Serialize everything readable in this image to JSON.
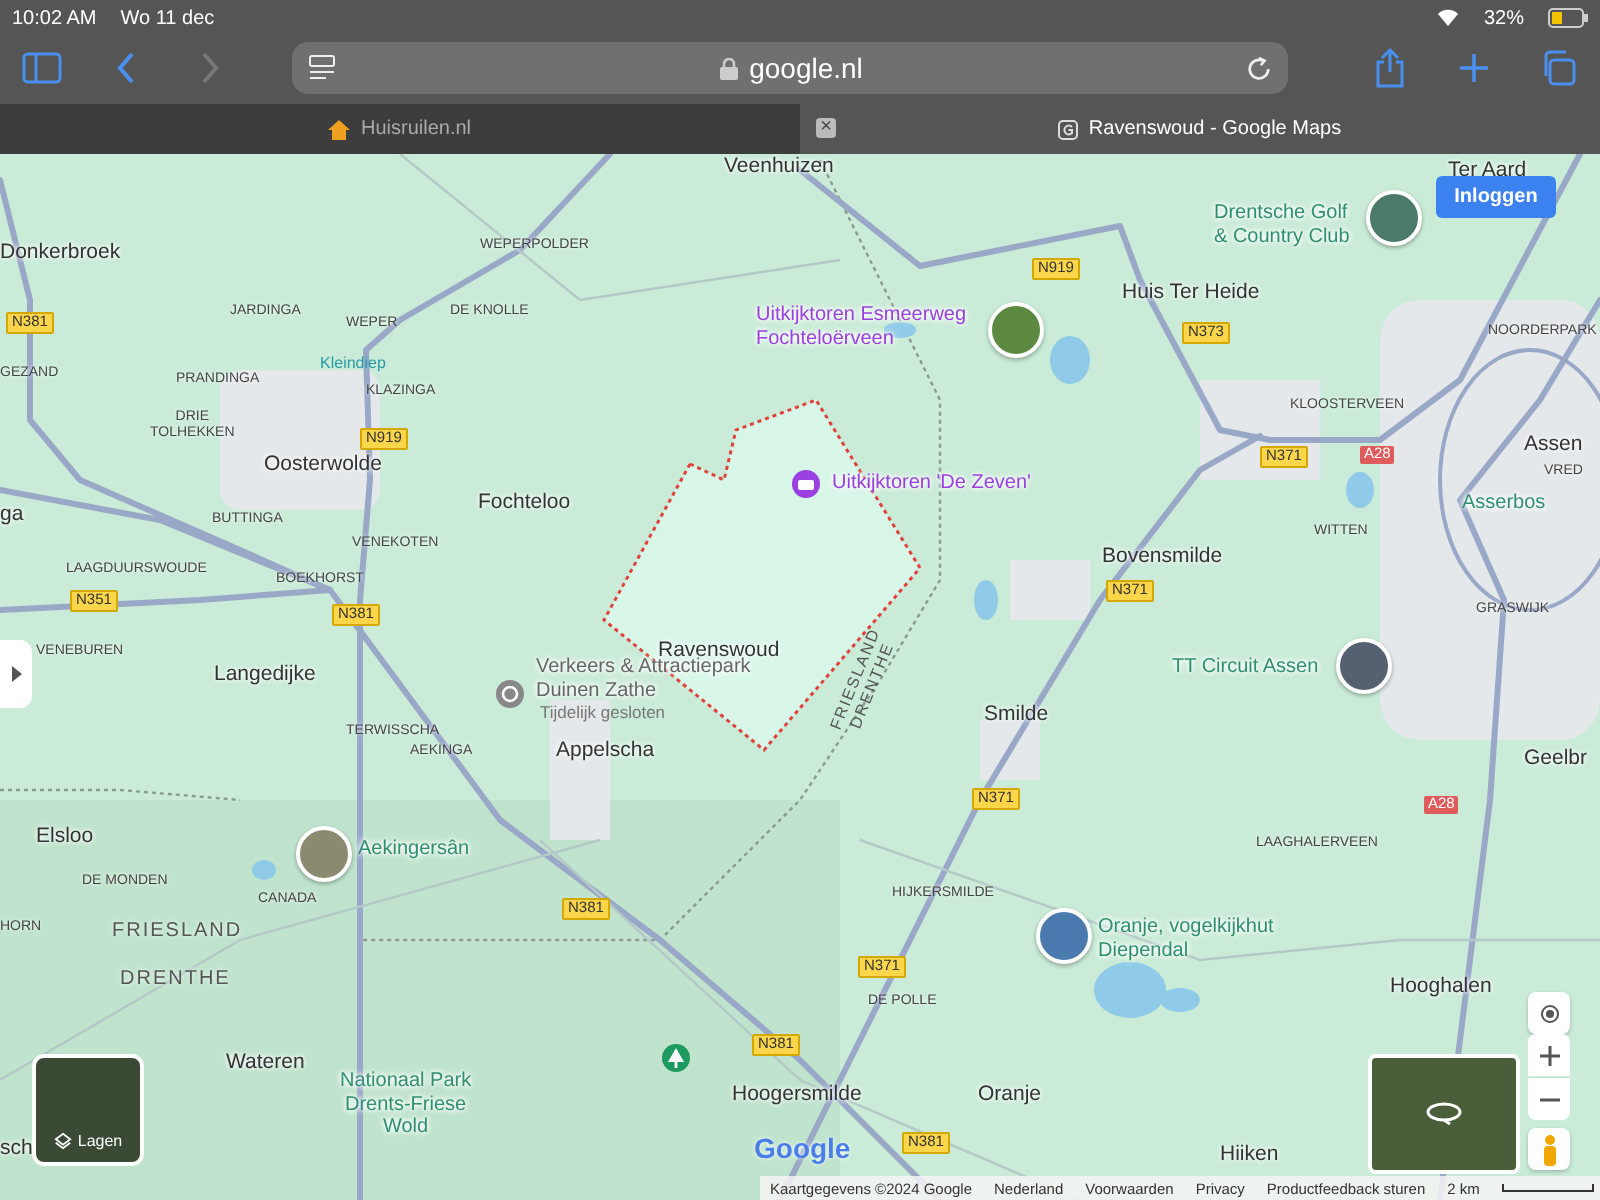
{
  "status_bar": {
    "time": "10:02 AM",
    "date": "Wo 11 dec",
    "battery": "32%"
  },
  "toolbar": {
    "back_disabled": false,
    "forward_disabled": true,
    "url": "google.nl"
  },
  "tabs": [
    {
      "title": "Huisruilen.nl",
      "selected": false
    },
    {
      "title": "Ravenswoud - Google Maps",
      "selected": true,
      "close_symbol": "×"
    }
  ],
  "map": {
    "labels": [
      {
        "text": "Veenhuizen",
        "kind": "place"
      },
      {
        "text": "Ter Aard",
        "kind": "place"
      },
      {
        "text": "Donkerbroek",
        "kind": "place"
      },
      {
        "text": "WEPERPOLDER",
        "kind": "hamlet"
      },
      {
        "text": "N381",
        "kind": "road"
      },
      {
        "text": "JARDINGA",
        "kind": "hamlet"
      },
      {
        "text": "WEPER",
        "kind": "hamlet"
      },
      {
        "text": "DE KNOLLE",
        "kind": "hamlet"
      },
      {
        "text": "Kleindiep",
        "kind": "water"
      },
      {
        "text": "GEZAND",
        "kind": "hamlet"
      },
      {
        "text": "PRANDINGA",
        "kind": "hamlet"
      },
      {
        "text": "KLAZINGA",
        "kind": "hamlet"
      },
      {
        "text": "DRIE\nTOLHEKKEN",
        "kind": "hamlet"
      },
      {
        "text": "N919",
        "kind": "road"
      },
      {
        "text": "Oosterwolde",
        "kind": "place"
      },
      {
        "text": "Fochteloo",
        "kind": "place"
      },
      {
        "text": "ga",
        "kind": "place"
      },
      {
        "text": "BUTTINGA",
        "kind": "hamlet"
      },
      {
        "text": "VENEKOTEN",
        "kind": "hamlet"
      },
      {
        "text": "LAAGDUURSWOUDE",
        "kind": "hamlet"
      },
      {
        "text": "BOEKHORST",
        "kind": "hamlet"
      },
      {
        "text": "N351",
        "kind": "road"
      },
      {
        "text": "N381",
        "kind": "road"
      },
      {
        "text": "Ravenswoud",
        "kind": "place"
      },
      {
        "text": "VENEBUREN",
        "kind": "hamlet"
      },
      {
        "text": "Langedijke",
        "kind": "place"
      },
      {
        "text": "Verkeers & Attractiepark\nDuinen Zathe",
        "kind": "poi-gray"
      },
      {
        "text": "Tijdelijk gesloten",
        "kind": "note"
      },
      {
        "text": "TERWISSCHA",
        "kind": "hamlet"
      },
      {
        "text": "AEKINGA",
        "kind": "hamlet"
      },
      {
        "text": "Appelscha",
        "kind": "place"
      },
      {
        "text": "Elsloo",
        "kind": "place"
      },
      {
        "text": "Aekingersân",
        "kind": "poi-green"
      },
      {
        "text": "DE MONDEN",
        "kind": "hamlet"
      },
      {
        "text": "CANADA",
        "kind": "hamlet"
      },
      {
        "text": "HORN",
        "kind": "hamlet"
      },
      {
        "text": "FRIESLAND",
        "kind": "region"
      },
      {
        "text": "DRENTHE",
        "kind": "region"
      },
      {
        "text": "N381",
        "kind": "road"
      },
      {
        "text": "Wateren",
        "kind": "place"
      },
      {
        "text": "Nationaal Park\nDrents-Friese\nWold",
        "kind": "poi-green"
      },
      {
        "text": "N381",
        "kind": "road"
      },
      {
        "text": "Hoogersmilde",
        "kind": "place"
      },
      {
        "text": "sch",
        "kind": "place"
      },
      {
        "text": "Drentsche Golf\n& Country Club",
        "kind": "poi-green"
      },
      {
        "text": "N919",
        "kind": "road"
      },
      {
        "text": "Huis Ter Heide",
        "kind": "place"
      },
      {
        "text": "Uitkijktoren Esmeerweg\nFochteloërveen",
        "kind": "poi-purple"
      },
      {
        "text": "N373",
        "kind": "road"
      },
      {
        "text": "NOORDERPARK",
        "kind": "hamlet"
      },
      {
        "text": "KLOOSTERVEEN",
        "kind": "hamlet"
      },
      {
        "text": "N371",
        "kind": "road"
      },
      {
        "text": "A28",
        "kind": "motorway"
      },
      {
        "text": "Assen",
        "kind": "place"
      },
      {
        "text": "VRED",
        "kind": "hamlet"
      },
      {
        "text": "Uitkijktoren 'De Zeven'",
        "kind": "poi-purple"
      },
      {
        "text": "Asserbos",
        "kind": "poi-green"
      },
      {
        "text": "WITTEN",
        "kind": "hamlet"
      },
      {
        "text": "Bovensmilde",
        "kind": "place"
      },
      {
        "text": "N371",
        "kind": "road"
      },
      {
        "text": "GRASWIJK",
        "kind": "hamlet"
      },
      {
        "text": "TT Circuit Assen",
        "kind": "poi-green"
      },
      {
        "text": "FRIESLAND\nDRENTHE",
        "kind": "border"
      },
      {
        "text": "Smilde",
        "kind": "place"
      },
      {
        "text": "N371",
        "kind": "road"
      },
      {
        "text": "Geelbr",
        "kind": "place"
      },
      {
        "text": "A28",
        "kind": "motorway"
      },
      {
        "text": "LAAGHALERVEEN",
        "kind": "hamlet"
      },
      {
        "text": "HIJKERSMILDE",
        "kind": "hamlet"
      },
      {
        "text": "Oranje, vogelkijkhut\nDiependal",
        "kind": "poi-green"
      },
      {
        "text": "N371",
        "kind": "road"
      },
      {
        "text": "DE POLLE",
        "kind": "hamlet"
      },
      {
        "text": "Hooghalen",
        "kind": "place"
      },
      {
        "text": "Oranje",
        "kind": "place"
      },
      {
        "text": "N381",
        "kind": "road"
      },
      {
        "text": "Hiiken",
        "kind": "place"
      }
    ],
    "login_button": "Inloggen",
    "layers_button": "Lagen",
    "logo": "Google",
    "footer": [
      "Kaartgegevens ©2024 Google",
      "Nederland",
      "Voorwaarden",
      "Privacy",
      "Productfeedback sturen"
    ],
    "scale": "2 km"
  }
}
